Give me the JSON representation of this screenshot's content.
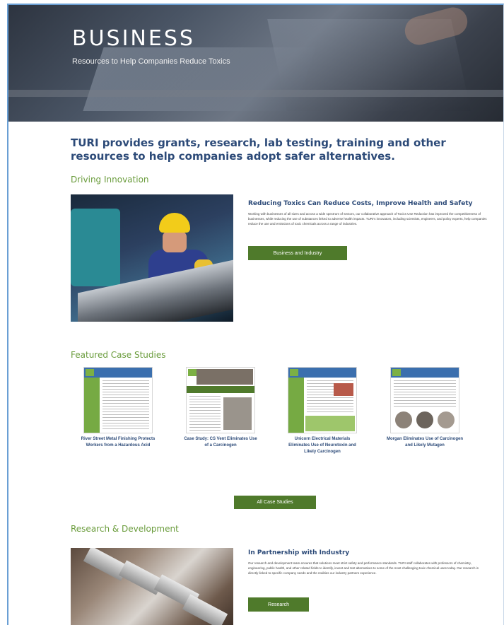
{
  "hero": {
    "title": "BUSINESS",
    "subtitle": "Resources to Help Companies Reduce Toxics"
  },
  "intro": "TURI provides grants, research, lab testing, training and other resources to help companies adopt safer alternatives.",
  "driving_innovation": {
    "heading": "Driving Innovation",
    "feature_title": "Reducing Toxics Can Reduce Costs, Improve Health and Safety",
    "feature_body": "Working with businesses of all sizes and across a wide spectrum of sectors, our collaborative approach of Toxics Use Reduction has improved the competitiveness of businesses, while reducing the use of substances linked to adverse health impacts. TURI's innovators, including scientists, engineers, and policy experts, help companies reduce the use and emissions of toxic chemicals across a range of industries.",
    "button": "Business and Industry"
  },
  "case_studies": {
    "heading": "Featured Case Studies",
    "items": [
      {
        "label": "River Street Metal Finishing Protects Workers from a Hazardous Acid"
      },
      {
        "label": "Case Study: CS Vent Eliminates Use of a Carcinogen"
      },
      {
        "label": "Unicorn Electrical Materials Eliminates Use of Neurotoxin and Likely Carcinogen"
      },
      {
        "label": "Morgan Eliminates Use of Carcinogen and Likely Mutagen"
      }
    ],
    "button": "All Case Studies"
  },
  "research": {
    "heading": "Research & Development",
    "feature_title": "In Partnership with Industry",
    "feature_body": "Our research and development team ensures that solutions meet strict safety and performance standards. TURI staff collaborates with professors of chemistry, engineering, public health, and other related fields to identify, invent and test alternatives to some of the most challenging toxic chemical uses today. Our research is directly linked to specific company needs and the realities our industry partners experience.",
    "button": "Research"
  }
}
